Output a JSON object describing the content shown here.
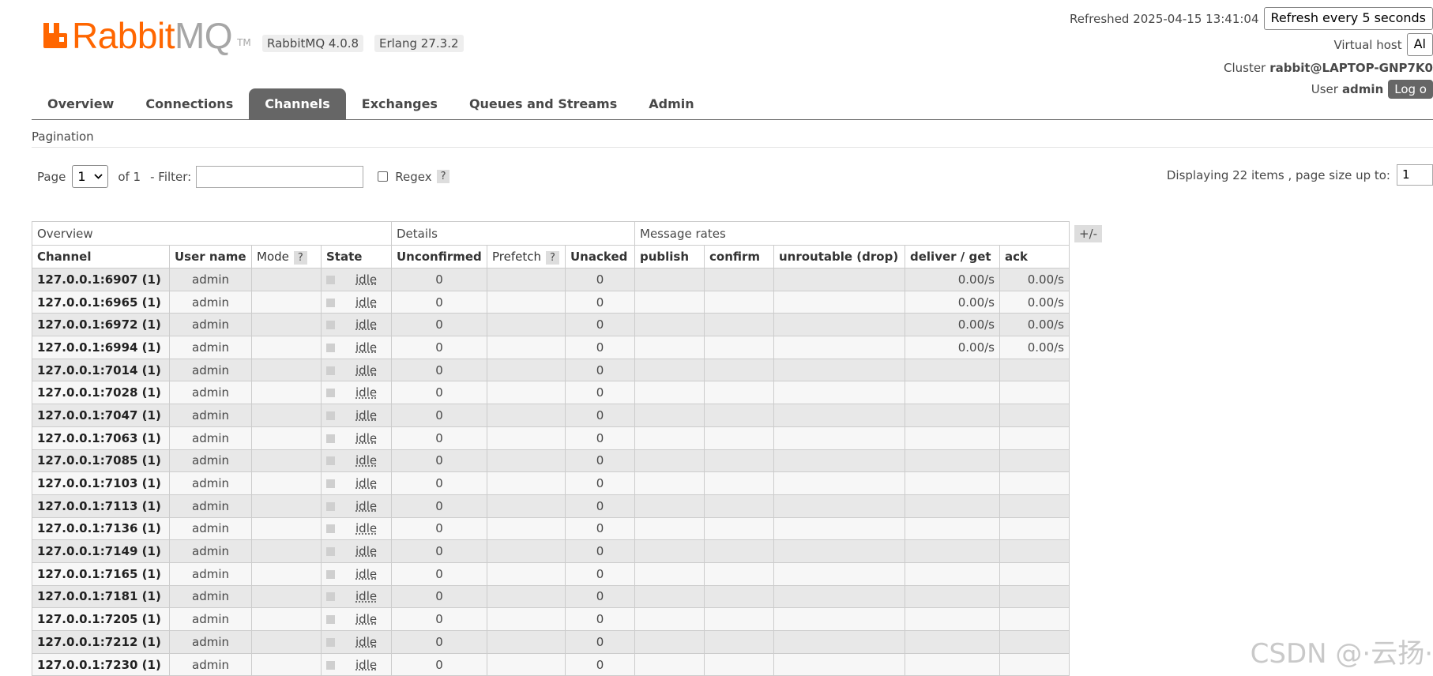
{
  "logo": {
    "rabbit": "Rabbit",
    "mq": "MQ",
    "tm": "TM"
  },
  "versions": {
    "rabbitmq": "RabbitMQ 4.0.8",
    "erlang": "Erlang 27.3.2"
  },
  "header": {
    "refreshed_label": "Refreshed 2025-04-15 13:41:04",
    "refresh_select": "Refresh every 5 seconds",
    "vhost_label": "Virtual host",
    "vhost_value": "Al",
    "cluster_label": "Cluster",
    "cluster_value": "rabbit@LAPTOP-GNP7K0",
    "user_label": "User",
    "user_value": "admin",
    "logout": "Log o"
  },
  "tabs": [
    "Overview",
    "Connections",
    "Channels",
    "Exchanges",
    "Queues and Streams",
    "Admin"
  ],
  "active_tab": "Channels",
  "pagination": {
    "title": "Pagination",
    "page_label": "Page",
    "page_value": "1",
    "of_label": "of 1",
    "filter_label": "- Filter:",
    "regex_label": "Regex",
    "help": "?",
    "displaying": "Displaying 22 items , page size up to:",
    "page_size": "1"
  },
  "table": {
    "groups": [
      "Overview",
      "Details",
      "Message rates"
    ],
    "columns": [
      "Channel",
      "User name",
      "Mode",
      "State",
      "Unconfirmed",
      "Prefetch",
      "Unacked",
      "publish",
      "confirm",
      "unroutable (drop)",
      "deliver / get",
      "ack"
    ],
    "plus_minus": "+/-",
    "rows": [
      {
        "channel": "127.0.0.1:6907 (1)",
        "user": "admin",
        "state": "idle",
        "unconfirmed": "0",
        "unacked": "0",
        "deliver_get": "0.00/s",
        "ack": "0.00/s"
      },
      {
        "channel": "127.0.0.1:6965 (1)",
        "user": "admin",
        "state": "idle",
        "unconfirmed": "0",
        "unacked": "0",
        "deliver_get": "0.00/s",
        "ack": "0.00/s"
      },
      {
        "channel": "127.0.0.1:6972 (1)",
        "user": "admin",
        "state": "idle",
        "unconfirmed": "0",
        "unacked": "0",
        "deliver_get": "0.00/s",
        "ack": "0.00/s"
      },
      {
        "channel": "127.0.0.1:6994 (1)",
        "user": "admin",
        "state": "idle",
        "unconfirmed": "0",
        "unacked": "0",
        "deliver_get": "0.00/s",
        "ack": "0.00/s"
      },
      {
        "channel": "127.0.0.1:7014 (1)",
        "user": "admin",
        "state": "idle",
        "unconfirmed": "0",
        "unacked": "0",
        "deliver_get": "",
        "ack": ""
      },
      {
        "channel": "127.0.0.1:7028 (1)",
        "user": "admin",
        "state": "idle",
        "unconfirmed": "0",
        "unacked": "0",
        "deliver_get": "",
        "ack": ""
      },
      {
        "channel": "127.0.0.1:7047 (1)",
        "user": "admin",
        "state": "idle",
        "unconfirmed": "0",
        "unacked": "0",
        "deliver_get": "",
        "ack": ""
      },
      {
        "channel": "127.0.0.1:7063 (1)",
        "user": "admin",
        "state": "idle",
        "unconfirmed": "0",
        "unacked": "0",
        "deliver_get": "",
        "ack": ""
      },
      {
        "channel": "127.0.0.1:7085 (1)",
        "user": "admin",
        "state": "idle",
        "unconfirmed": "0",
        "unacked": "0",
        "deliver_get": "",
        "ack": ""
      },
      {
        "channel": "127.0.0.1:7103 (1)",
        "user": "admin",
        "state": "idle",
        "unconfirmed": "0",
        "unacked": "0",
        "deliver_get": "",
        "ack": ""
      },
      {
        "channel": "127.0.0.1:7113 (1)",
        "user": "admin",
        "state": "idle",
        "unconfirmed": "0",
        "unacked": "0",
        "deliver_get": "",
        "ack": ""
      },
      {
        "channel": "127.0.0.1:7136 (1)",
        "user": "admin",
        "state": "idle",
        "unconfirmed": "0",
        "unacked": "0",
        "deliver_get": "",
        "ack": ""
      },
      {
        "channel": "127.0.0.1:7149 (1)",
        "user": "admin",
        "state": "idle",
        "unconfirmed": "0",
        "unacked": "0",
        "deliver_get": "",
        "ack": ""
      },
      {
        "channel": "127.0.0.1:7165 (1)",
        "user": "admin",
        "state": "idle",
        "unconfirmed": "0",
        "unacked": "0",
        "deliver_get": "",
        "ack": ""
      },
      {
        "channel": "127.0.0.1:7181 (1)",
        "user": "admin",
        "state": "idle",
        "unconfirmed": "0",
        "unacked": "0",
        "deliver_get": "",
        "ack": ""
      },
      {
        "channel": "127.0.0.1:7205 (1)",
        "user": "admin",
        "state": "idle",
        "unconfirmed": "0",
        "unacked": "0",
        "deliver_get": "",
        "ack": ""
      },
      {
        "channel": "127.0.0.1:7212 (1)",
        "user": "admin",
        "state": "idle",
        "unconfirmed": "0",
        "unacked": "0",
        "deliver_get": "",
        "ack": ""
      },
      {
        "channel": "127.0.0.1:7230 (1)",
        "user": "admin",
        "state": "idle",
        "unconfirmed": "0",
        "unacked": "0",
        "deliver_get": "",
        "ack": ""
      }
    ]
  },
  "watermark": "CSDN @·云扬·",
  "colors": {
    "brand_orange": "#ff6600",
    "tab_active": "#666666",
    "row_odd": "#e8e8e8",
    "row_even": "#f7f7f7"
  }
}
